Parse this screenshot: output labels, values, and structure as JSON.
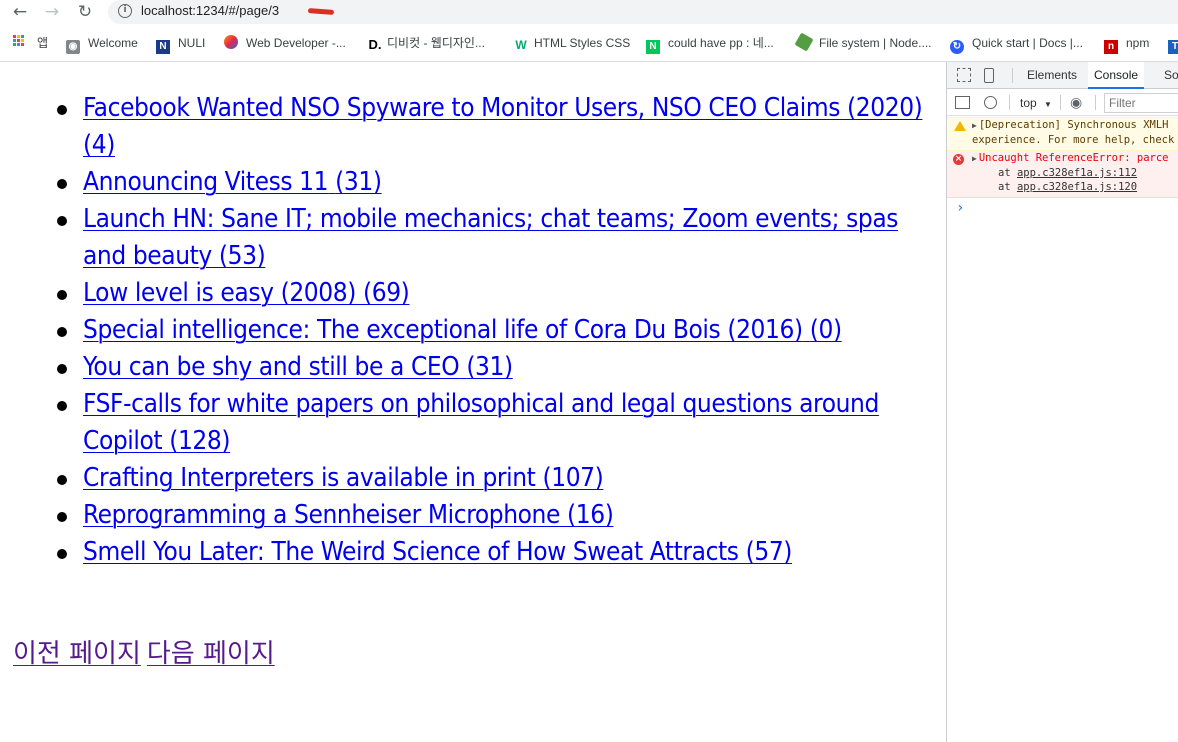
{
  "browser": {
    "url": "localhost:1234/#/page/3",
    "bookmarks": [
      {
        "label": "앱",
        "icon": "apps-grid-icon"
      },
      {
        "label": "Welcome",
        "icon": "camera-icon"
      },
      {
        "label": "NULI",
        "icon": "nuli-icon"
      },
      {
        "label": "Web Developer -...",
        "icon": "web-developer-icon"
      },
      {
        "label": "디비컷 - 웹디자인...",
        "icon": "dibicut-icon"
      },
      {
        "label": "HTML Styles CSS",
        "icon": "w3schools-icon"
      },
      {
        "label": "could have pp : 네...",
        "icon": "naver-icon"
      },
      {
        "label": "File system | Node....",
        "icon": "nodejs-icon"
      },
      {
        "label": "Quick start | Docs |...",
        "icon": "docs-icon"
      },
      {
        "label": "npm",
        "icon": "npm-icon"
      }
    ]
  },
  "stories": [
    {
      "title": "Facebook Wanted NSO Spyware to Monitor Users, NSO CEO Claims (2020)",
      "comments": "(4)"
    },
    {
      "title": "Announcing Vitess 11",
      "comments": "(31)"
    },
    {
      "title": "Launch HN: Sane IT; mobile mechanics; chat teams; Zoom events; spas and beauty",
      "comments": "(53)"
    },
    {
      "title": "Low level is easy (2008)",
      "comments": "(69)"
    },
    {
      "title": "Special intelligence: The exceptional life of Cora Du Bois (2016)",
      "comments": "(0)"
    },
    {
      "title": "You can be shy and still be a CEO",
      "comments": "(31)"
    },
    {
      "title": "FSF-calls for white papers on philosophical and legal questions around Copilot",
      "comments": "(128)"
    },
    {
      "title": "Crafting Interpreters is available in print",
      "comments": "(107)"
    },
    {
      "title": "Reprogramming a Sennheiser Microphone",
      "comments": "(16)"
    },
    {
      "title": "Smell You Later: The Weird Science of How Sweat Attracts",
      "comments": "(57)"
    }
  ],
  "pager": {
    "prev_label": "이전 페이지",
    "next_label": "다음 페이지"
  },
  "devtools": {
    "tabs": [
      "Elements",
      "Console",
      "So"
    ],
    "active_tab": "Console",
    "context": "top",
    "filter_placeholder": "Filter",
    "warning": {
      "line1": "[Deprecation] Synchronous XMLH",
      "line2": "experience. For more help, check"
    },
    "error": {
      "line1": "Uncaught ReferenceError: parce",
      "stack1_prefix": "at ",
      "stack1_link": "app.c328ef1a.js:112",
      "stack2_prefix": "at ",
      "stack2_link": "app.c328ef1a.js:120"
    },
    "prompt": "›"
  },
  "colors": {
    "link": "#0000ee",
    "visited": "#551a8b",
    "devtools_accent": "#1a73e8"
  }
}
